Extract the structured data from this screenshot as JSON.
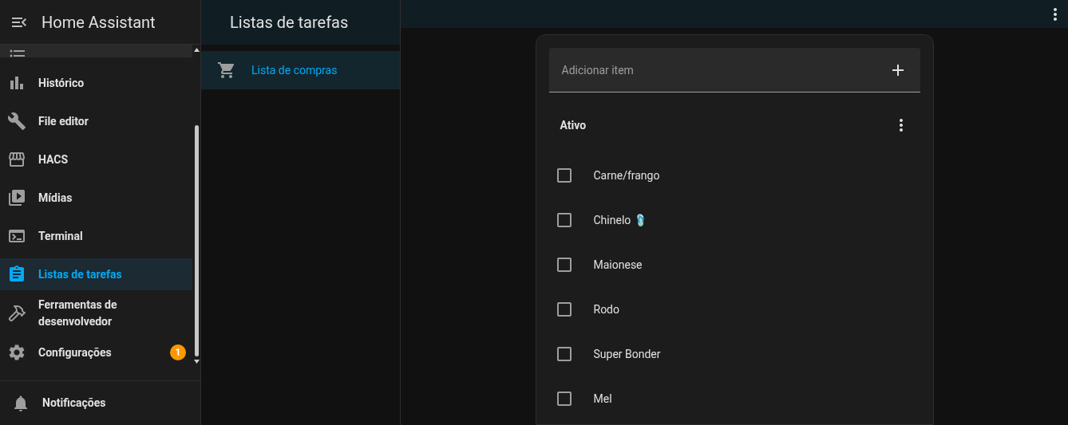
{
  "sidebar": {
    "title": "Home Assistant",
    "items": [
      {
        "label": "Histórico",
        "selected": false
      },
      {
        "label": "File editor",
        "selected": false
      },
      {
        "label": "HACS",
        "selected": false
      },
      {
        "label": "Mídias",
        "selected": false
      },
      {
        "label": "Terminal",
        "selected": false
      },
      {
        "label": "Listas de tarefas",
        "selected": true
      },
      {
        "label": "Ferramentas de desenvolvedor",
        "selected": false
      },
      {
        "label": "Configurações",
        "selected": false,
        "badge": "1"
      }
    ],
    "footer": {
      "label": "Notificações"
    }
  },
  "lists_panel": {
    "title": "Listas de tarefas",
    "items": [
      {
        "label": "Lista de compras",
        "selected": true
      }
    ]
  },
  "todo": {
    "add_field": {
      "placeholder": "Adicionar item"
    },
    "section": "Ativo",
    "items": [
      {
        "label": "Carne/frango",
        "checked": false
      },
      {
        "label": "Chinelo 🩴",
        "checked": false
      },
      {
        "label": "Maionese",
        "checked": false
      },
      {
        "label": "Rodo",
        "checked": false
      },
      {
        "label": "Super Bonder",
        "checked": false
      },
      {
        "label": "Mel",
        "checked": false
      }
    ]
  }
}
